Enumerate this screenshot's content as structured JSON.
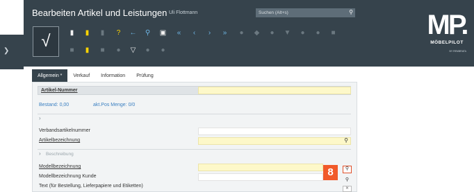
{
  "sidebar": {
    "expand_icon": "chevron-right-icon"
  },
  "header": {
    "title": "Bearbeiten Artikel und Leistungen",
    "user": "Uli Flottmann",
    "search": {
      "placeholder": "Suchen (Alt+s)",
      "value": "",
      "icon": "search-icon"
    },
    "confirm_icon": "checkmark-icon",
    "colors": {
      "header_bg": "#36434c",
      "accent_yellow": "#ffd400",
      "accent_blue": "#6fb8e8",
      "badge": "#f15a29"
    }
  },
  "toolbar": {
    "row1": [
      "new-document-icon",
      "note-icon",
      "delete-icon",
      "help-icon",
      "back-icon",
      "search-icon",
      "print-icon",
      "first-icon",
      "previous-icon",
      "next-icon",
      "last-icon",
      "users-icon",
      "tag-icon",
      "settings-icon",
      "filter-icon",
      "record-icon",
      "link-icon",
      "image-icon"
    ],
    "row2": [
      "grid-icon",
      "flag-icon",
      "calendar-icon",
      "shield-icon",
      "check-shield-icon",
      "globe-icon",
      "brush-icon"
    ]
  },
  "logo": {
    "mark": "MP.",
    "brand": "MÖBELPILOT",
    "sub": "BY REMBRATA"
  },
  "tabs": [
    {
      "label": "Allgemein *",
      "active": true
    },
    {
      "label": "Verkauf",
      "active": false
    },
    {
      "label": "Information",
      "active": false
    },
    {
      "label": "Prüfung",
      "active": false
    }
  ],
  "form": {
    "artikel_nummer": {
      "label": "Artikel-Nummer",
      "value": ""
    },
    "bestand": "Bestand: 0,00",
    "akt_pos_menge": "akt.Pos Menge: 0/0",
    "verbandsartikelnummer": {
      "label": "Verbandsartikelnummer",
      "value": ""
    },
    "artikelbezeichnung": {
      "label": "Artikelbezeichnung",
      "value": ""
    },
    "beschreibung_section": "Beschreibung",
    "modellbezeichnung": {
      "label": "Modellbezeichnung",
      "value": ""
    },
    "modellbezeichnung_kunde": {
      "label": "Modellbezeichnung Kunde",
      "value": ""
    },
    "text_bestellung": {
      "label": "Text (für Bestellung, Lieferpapiere und Etiketten)"
    }
  },
  "step_badge": "8"
}
